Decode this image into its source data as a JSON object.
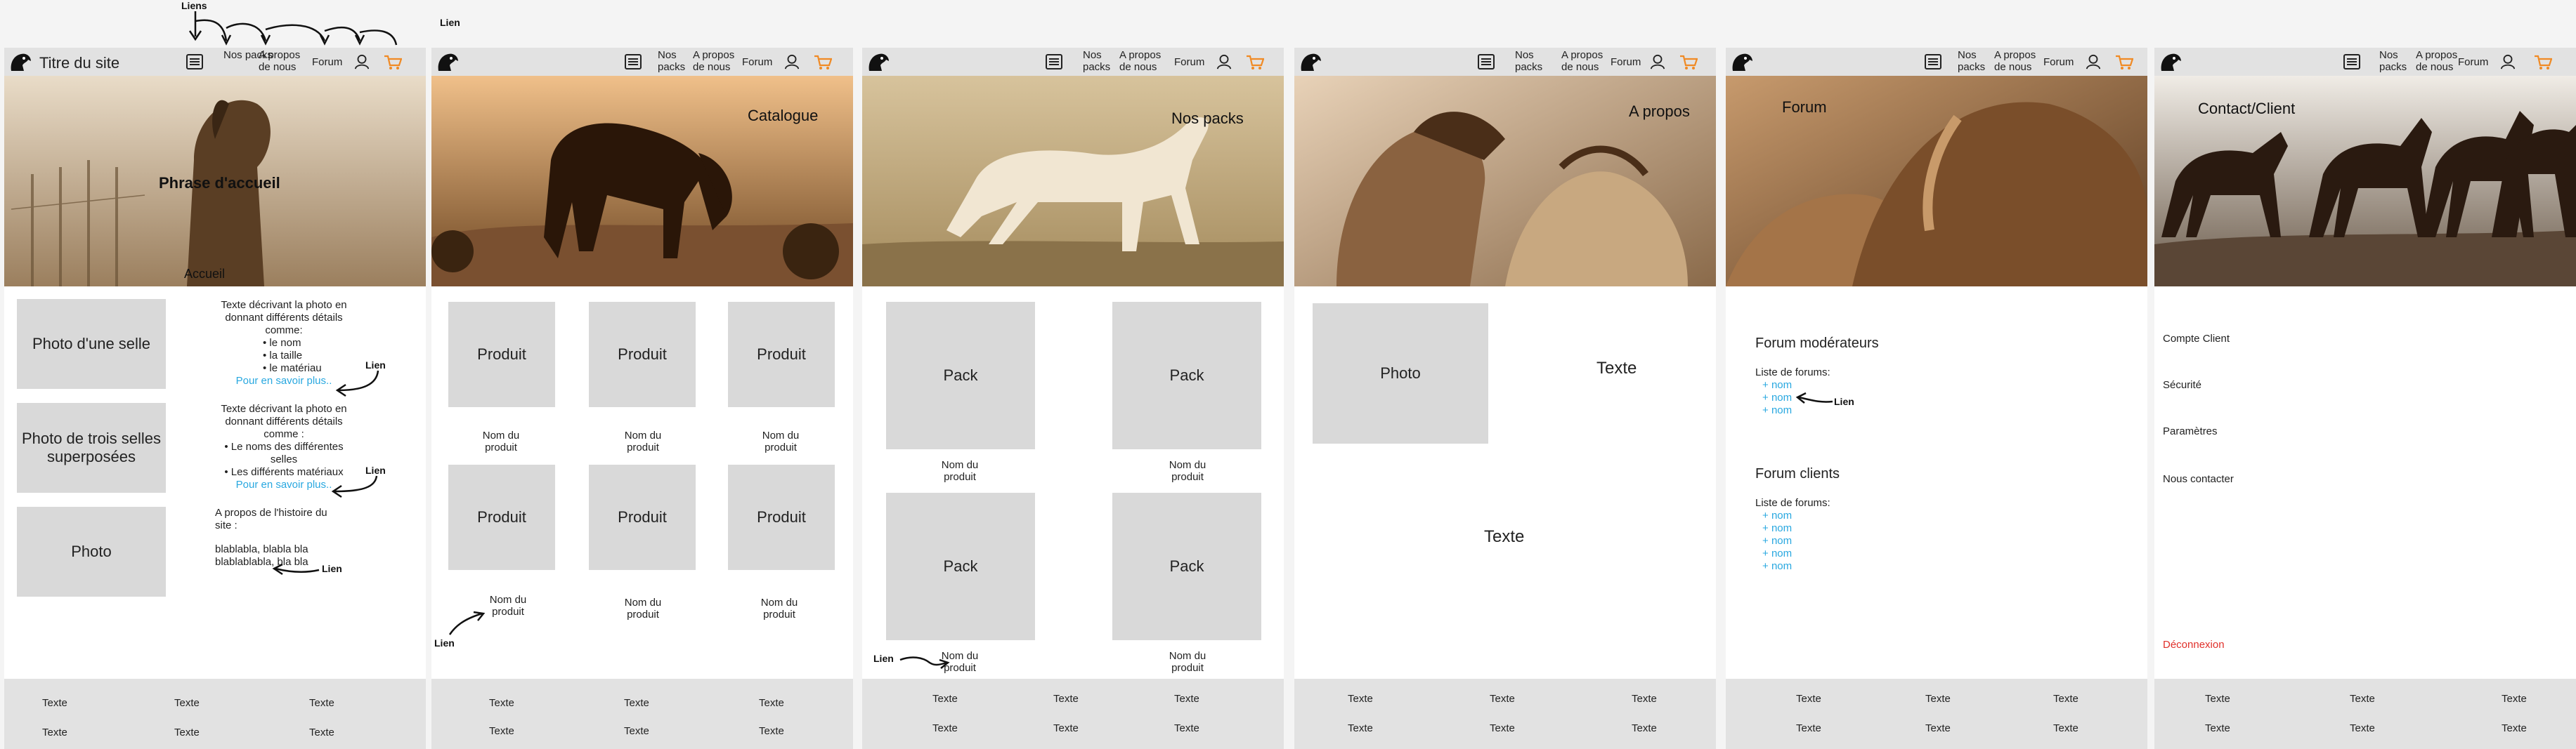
{
  "annotations": {
    "liens_top": "Liens",
    "lien_top": "Lien",
    "lien": "Lien"
  },
  "nav": {
    "packs": "Nos packs",
    "about": "A propos de nous",
    "forum": "Forum"
  },
  "home": {
    "site_title": "Titre du site",
    "hero_phrase": "Phrase d'accueil",
    "hero_label": "Accueil",
    "photo1": "Photo d'une selle",
    "photo2": "Photo de trois selles superposées",
    "photo3": "Photo",
    "desc1_intro": "Texte décrivant la photo en donnant différents détails comme:",
    "desc1_items": [
      "le nom",
      "la taille",
      "le matériau"
    ],
    "more": "Pour en savoir plus..",
    "desc2_intro": "Texte décrivant la photo en donnant différents détails comme :",
    "desc2_items": [
      "Le noms des différentes selles",
      "Les différents matériaux"
    ],
    "history_title": "A propos de l'histoire du site :",
    "history_text": "blablabla, blabla bla blablablabla, bla bla"
  },
  "catalogue": {
    "hero_label": "Catalogue",
    "product": "Produit",
    "product_name": "Nom du produit"
  },
  "packs": {
    "hero_label": "Nos packs",
    "pack": "Pack",
    "product_name": "Nom du produit"
  },
  "about": {
    "hero_label": "A propos",
    "photo": "Photo",
    "text": "Texte"
  },
  "forum": {
    "hero_label": "Forum",
    "moderators_title": "Forum modérateurs",
    "list_label": "Liste de forums:",
    "name": "nom",
    "clients_title": "Forum clients"
  },
  "contact": {
    "hero_label": "Contact/Client",
    "items": [
      "Compte Client",
      "Sécurité",
      "Paramètres",
      "Nous contacter"
    ],
    "logout": "Déconnexion"
  },
  "footer": {
    "text": "Texte"
  },
  "colors": {
    "link": "#29a8e0",
    "cart": "#f08a24",
    "logout": "#e0302a",
    "gray": "#d9d9d9"
  }
}
